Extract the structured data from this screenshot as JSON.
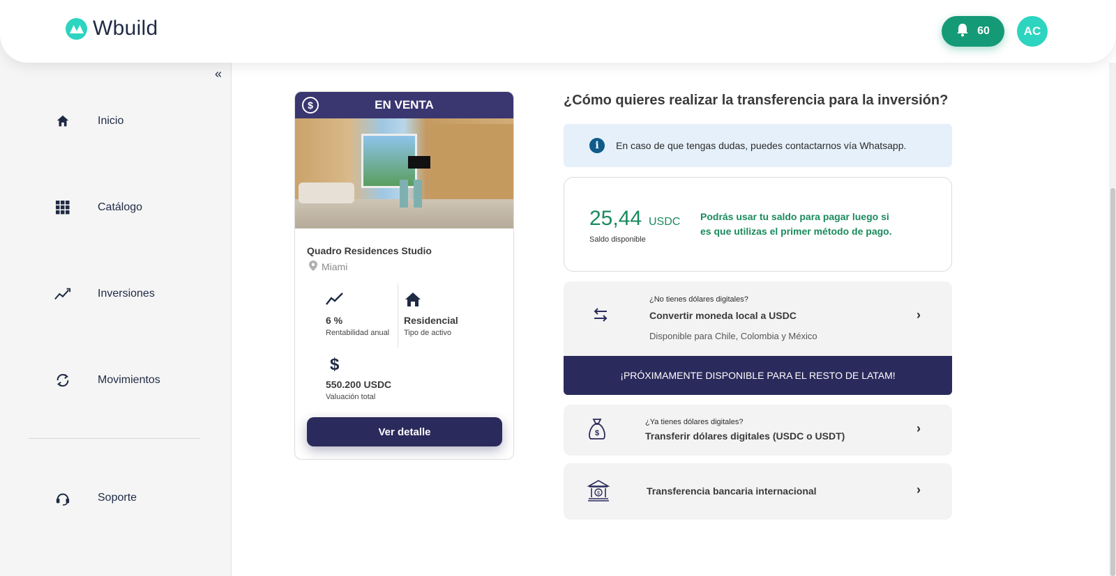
{
  "brand": {
    "name": "Wbuild",
    "color": "#2dd4bf"
  },
  "header": {
    "notification_count": "60",
    "avatar_initials": "AC"
  },
  "sidebar": {
    "collapse_label": "«",
    "items": [
      {
        "label": "Inicio",
        "icon": "home-icon"
      },
      {
        "label": "Catálogo",
        "icon": "grid-icon"
      },
      {
        "label": "Inversiones",
        "icon": "trend-icon"
      },
      {
        "label": "Movimientos",
        "icon": "sync-icon"
      }
    ],
    "support": {
      "label": "Soporte",
      "icon": "support-icon"
    }
  },
  "property": {
    "badge": "EN VENTA",
    "title": "Quadro Residences Studio",
    "location": "Miami",
    "stats": [
      {
        "value": "6 %",
        "label": "Rentabilidad anual",
        "icon": "trend-line-icon"
      },
      {
        "value": "Residencial",
        "label": "Tipo de activo",
        "icon": "house-icon"
      },
      {
        "value": "550.200 USDC",
        "label": "Valuación total",
        "icon": "dollar-icon"
      }
    ],
    "button_label": "Ver detalle"
  },
  "transfer": {
    "question": "¿Cómo quieres realizar la transferencia para la inversión?",
    "info": "En caso de que tengas dudas, puedes contactarnos vía Whatsapp.",
    "balance": {
      "amount": "25,44",
      "unit": "USDC",
      "label": "Saldo disponible",
      "note": "Podrás usar tu saldo para pagar luego si es que utilizas el primer método de pago."
    },
    "options": [
      {
        "small": "¿No tienes dólares digitales?",
        "main": "Convertir moneda local a USDC",
        "sub": "Disponible para Chile, Colombia y México",
        "icon": "swap-icon"
      },
      {
        "small": "¿Ya tienes dólares digitales?",
        "main": "Transferir dólares digitales (USDC o USDT)",
        "icon": "money-bag-icon"
      },
      {
        "main": "Transferencia bancaria internacional",
        "icon": "bank-icon"
      }
    ],
    "banner": "¡PRÓXIMAMENTE DISPONIBLE PARA EL RESTO DE LATAM!"
  },
  "colors": {
    "primary_dark": "#2b2a5c",
    "green": "#1a8a5e",
    "notif_green": "#149a76"
  }
}
